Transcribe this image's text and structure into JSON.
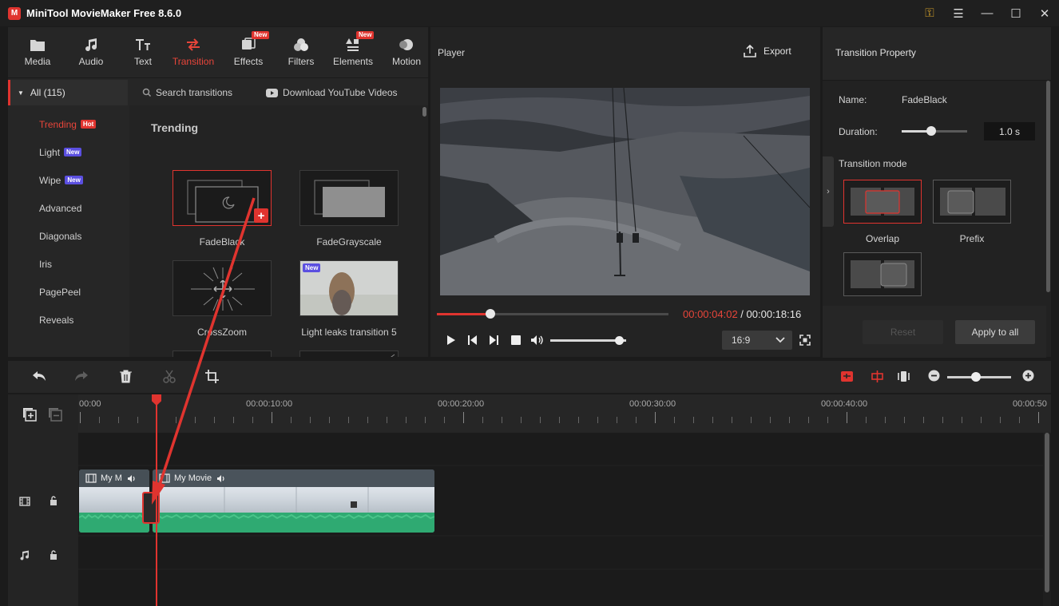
{
  "app": {
    "title": "MiniTool MovieMaker Free 8.6.0",
    "logo_letter": "M"
  },
  "window_controls": {
    "key": "⚿",
    "menu": "☰",
    "minimize": "—",
    "maximize": "☐",
    "close": "✕"
  },
  "toolbar": {
    "tabs": [
      {
        "label": "Media",
        "icon": "folder-icon"
      },
      {
        "label": "Audio",
        "icon": "music-note-icon"
      },
      {
        "label": "Text",
        "icon": "text-icon"
      },
      {
        "label": "Transition",
        "icon": "transition-arrows-icon",
        "active": true
      },
      {
        "label": "Effects",
        "icon": "effects-icon",
        "badge": "New"
      },
      {
        "label": "Filters",
        "icon": "filters-icon"
      },
      {
        "label": "Elements",
        "icon": "elements-icon",
        "badge": "New"
      },
      {
        "label": "Motion",
        "icon": "motion-icon"
      }
    ]
  },
  "categories": {
    "all": "All (115)",
    "items": [
      {
        "label": "Trending",
        "tag": "Hot"
      },
      {
        "label": "Light",
        "tag": "New"
      },
      {
        "label": "Wipe",
        "tag": "New"
      },
      {
        "label": "Advanced"
      },
      {
        "label": "Diagonals"
      },
      {
        "label": "Iris"
      },
      {
        "label": "PagePeel"
      },
      {
        "label": "Reveals"
      }
    ]
  },
  "library": {
    "search_placeholder": "Search transitions",
    "download_label": "Download YouTube Videos",
    "section_title": "Trending",
    "items": [
      {
        "label": "FadeBlack"
      },
      {
        "label": "FadeGrayscale"
      },
      {
        "label": "CrossZoom"
      },
      {
        "label": "Light leaks transition 5",
        "tag": "New"
      }
    ],
    "add_label": "+"
  },
  "player": {
    "title": "Player",
    "export_label": "Export",
    "current_time": "00:00:04:02",
    "separator": " / ",
    "total_time": "00:00:18:16",
    "progress": 0.23,
    "volume": 0.9,
    "aspect_ratio": "16:9"
  },
  "properties": {
    "title": "Transition Property",
    "name_label": "Name:",
    "name_value": "FadeBlack",
    "duration_label": "Duration:",
    "duration_value": "1.0 s",
    "duration_slider": 0.45,
    "mode_label": "Transition mode",
    "modes": [
      {
        "label": "Overlap",
        "selected": true
      },
      {
        "label": "Prefix"
      },
      {
        "label": ""
      }
    ],
    "reset_label": "Reset",
    "apply_label": "Apply to all"
  },
  "timeline": {
    "ruler_labels": [
      "00:00",
      "00:00:10:00",
      "00:00:20:00",
      "00:00:30:00",
      "00:00:40:00",
      "00:00:50"
    ],
    "clips": [
      {
        "label": "My M"
      },
      {
        "label": "My Movie"
      }
    ],
    "zoom": 0.45
  },
  "colors": {
    "accent": "#e0342f",
    "audio_wave": "#2faa72",
    "new_tag": "#5b4fe0"
  }
}
